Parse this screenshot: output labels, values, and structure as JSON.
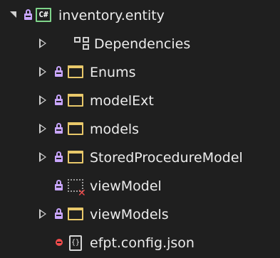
{
  "tree": {
    "project": {
      "label": "inventory.entity",
      "icon": "csharp-project-icon",
      "badge": "C#"
    },
    "items": [
      {
        "label": "Dependencies",
        "icon": "dependencies-icon"
      },
      {
        "label": "Enums",
        "icon": "folder-icon"
      },
      {
        "label": "modelExt",
        "icon": "folder-icon"
      },
      {
        "label": "models",
        "icon": "folder-icon"
      },
      {
        "label": "StoredProcedureModel",
        "icon": "folder-icon"
      },
      {
        "label": "viewModel",
        "icon": "missing-folder-icon"
      },
      {
        "label": "viewModels",
        "icon": "folder-icon"
      },
      {
        "label": "efpt.config.json",
        "icon": "json-file-icon"
      }
    ]
  },
  "colors": {
    "background": "#1f1f1f",
    "lock": "#c9a6ff",
    "folder": "#e8c86a",
    "csharp": "#7fd48a",
    "error": "#f14c4c"
  }
}
